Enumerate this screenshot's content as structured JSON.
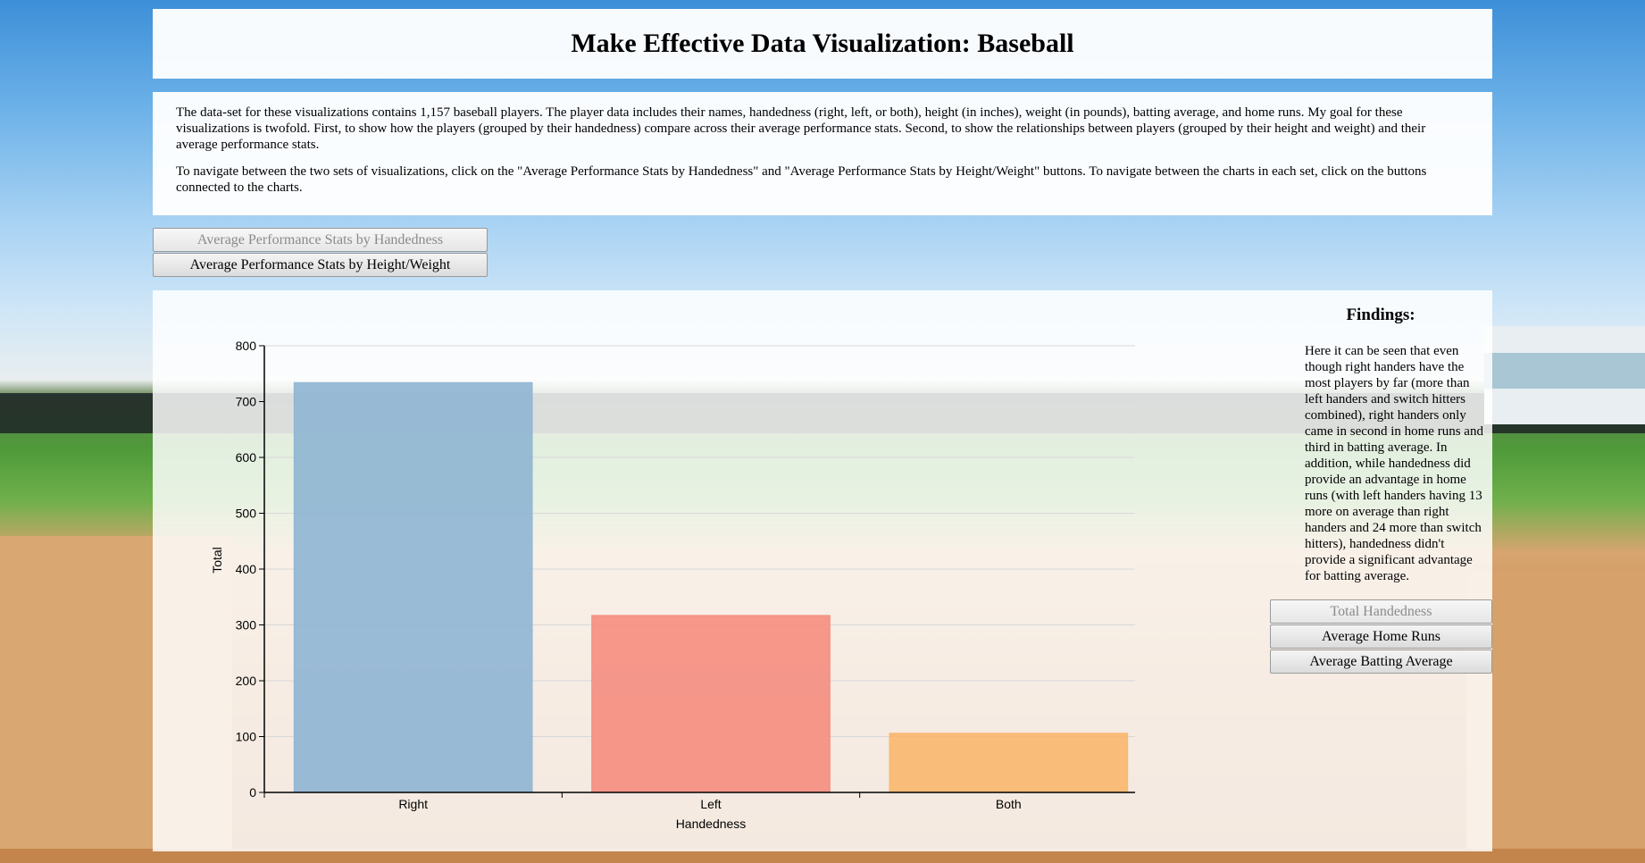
{
  "page": {
    "title": "Make Effective Data Visualization: Baseball",
    "intro_paragraphs": [
      "The data-set for these visualizations contains 1,157 baseball players. The player data includes their names, handedness (right, left, or both), height (in inches), weight (in pounds), batting average, and home runs. My goal for these visualizations is twofold. First, to show how the players (grouped by their handedness) compare across their average performance stats. Second, to show the relationships between players (grouped by their height and weight) and their average performance stats.",
      "To navigate between the two sets of visualizations, click on the \"Average Performance Stats by Handedness\" and \"Average Performance Stats by Height/Weight\" buttons. To navigate between the charts in each set, click on the buttons connected to the charts."
    ]
  },
  "nav": {
    "buttons": [
      {
        "label": "Average Performance Stats by Handedness",
        "active": true
      },
      {
        "label": "Average Performance Stats by Height/Weight",
        "active": false
      }
    ]
  },
  "findings": {
    "heading": "Findings:",
    "text": "Here it can be seen that even though right handers have the most players by far (more than left handers and switch hitters combined), right handers only came in second in home runs and third in batting average. In addition, while handedness did provide an advantage in home runs (with left handers having 13 more on average than right handers and 24 more than switch hitters), handedness didn't provide a significant advantage for batting average.",
    "buttons": [
      {
        "label": "Total Handedness",
        "active": true
      },
      {
        "label": "Average Home Runs",
        "active": false
      },
      {
        "label": "Average Batting Average",
        "active": false
      }
    ]
  },
  "chart_data": {
    "type": "bar",
    "categories": [
      "Right",
      "Left",
      "Both"
    ],
    "values": [
      734,
      317,
      106
    ],
    "colors": [
      "#8fb5d3",
      "#f58d80",
      "#f9b76e"
    ],
    "xlabel": "Handedness",
    "ylabel": "Total",
    "ylim": [
      0,
      800
    ],
    "yticks": [
      0,
      100,
      200,
      300,
      400,
      500,
      600,
      700,
      800
    ],
    "grid": true
  }
}
